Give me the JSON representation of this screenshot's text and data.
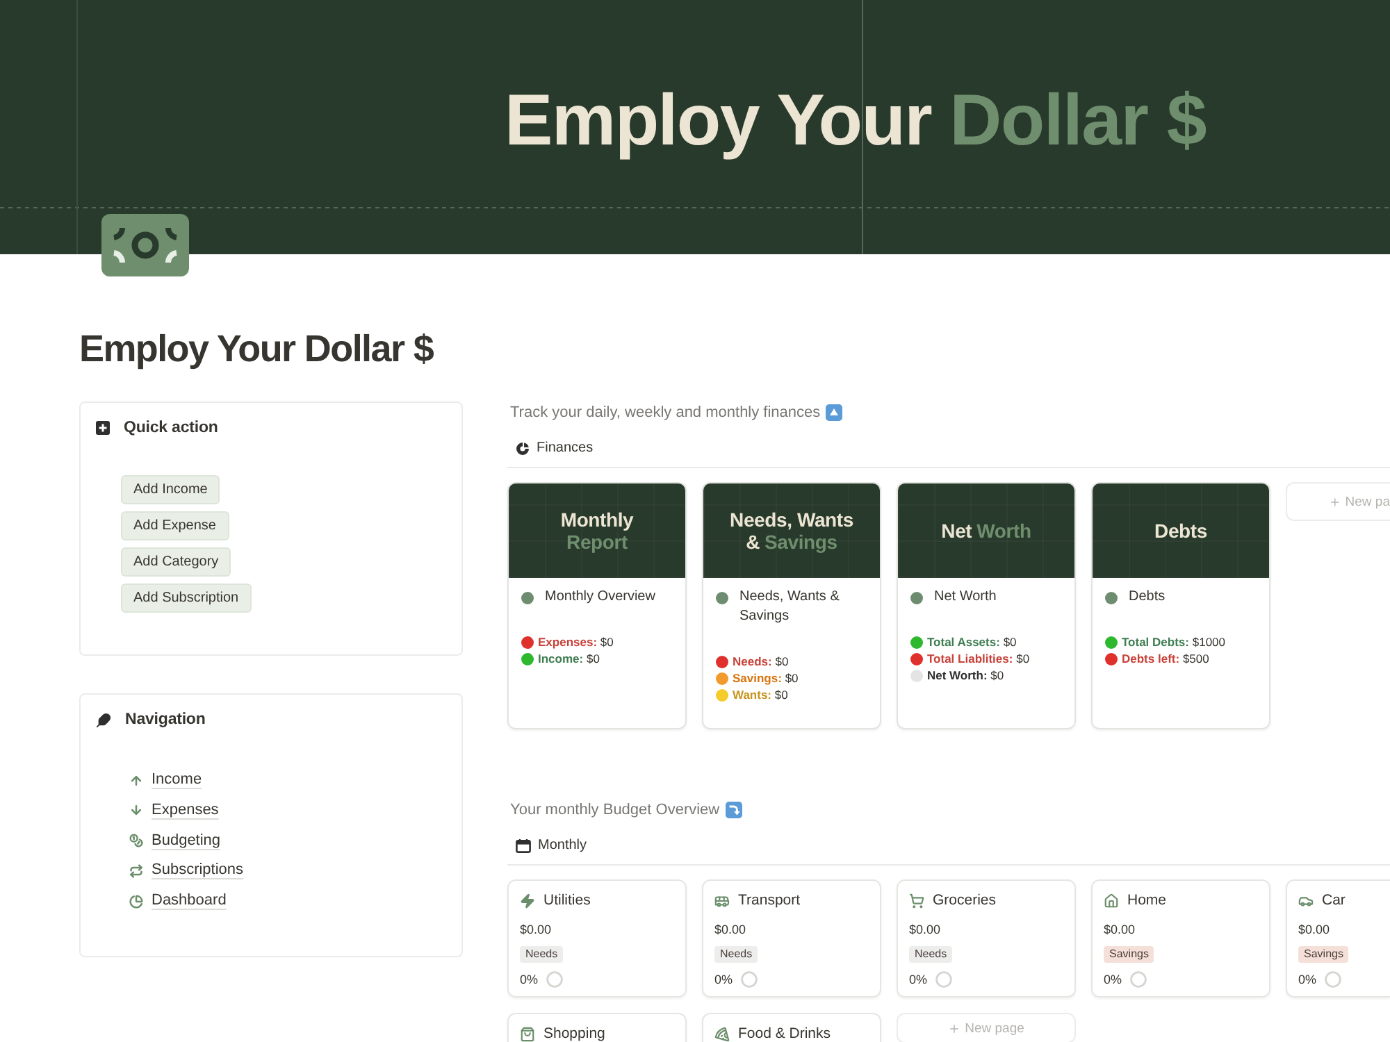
{
  "banner": {
    "title": [
      {
        "text": "Employ Your",
        "accent": false
      },
      {
        "text": "Dollar $",
        "accent": true
      }
    ]
  },
  "page": {
    "title": "Employ Your Dollar $"
  },
  "quick_action": {
    "title": "Quick action",
    "buttons": [
      "Add Income",
      "Add Expense",
      "Add Category",
      "Add Subscription"
    ]
  },
  "navigation": {
    "title": "Navigation",
    "links": [
      "Income",
      "Expenses",
      "Budgeting",
      "Subscriptions",
      "Dashboard"
    ]
  },
  "finances": {
    "intro": "Track your daily, weekly and monthly finances",
    "view": "Finances",
    "cards": [
      {
        "cover": [
          [
            {
              "text": "Monthly",
              "accent": false
            }
          ],
          [
            {
              "text": "Report",
              "accent": true
            }
          ]
        ],
        "title": "Monthly Overview",
        "stats": [
          {
            "label": "Expenses:",
            "value": "$0",
            "kind": "negative",
            "color": "#e0302c"
          },
          {
            "label": "Income:",
            "value": "$0",
            "kind": "positive",
            "color": "#2eb82e"
          }
        ]
      },
      {
        "cover": [
          [
            {
              "text": "Needs, Wants",
              "accent": false
            }
          ],
          [
            {
              "text": "&",
              "accent": false
            },
            {
              "text": "Savings",
              "accent": true
            }
          ]
        ],
        "title": "Needs, Wants & Savings",
        "stats": [
          {
            "label": "Needs:",
            "value": "$0",
            "kind": "negative",
            "color": "#e0302c"
          },
          {
            "label": "Savings:",
            "value": "$0",
            "kind": "caution",
            "color": "#f29a2e"
          },
          {
            "label": "Wants:",
            "value": "$0",
            "kind": "mild",
            "color": "#f5cc2a"
          }
        ]
      },
      {
        "cover": [
          [
            {
              "text": "Net",
              "accent": false
            },
            {
              "text": "Worth",
              "accent": true
            }
          ]
        ],
        "title": "Net Worth",
        "stats": [
          {
            "label": "Total Assets:",
            "value": "$0",
            "kind": "positive",
            "color": "#2eb82e"
          },
          {
            "label": "Total Liablities:",
            "value": "$0",
            "kind": "negative",
            "color": "#e0302c"
          },
          {
            "label": "Net Worth:",
            "value": "$0",
            "kind": "neutral",
            "color": "#e4e4e4"
          }
        ]
      },
      {
        "cover": [
          [
            {
              "text": "Debts",
              "accent": false
            }
          ]
        ],
        "title": "Debts",
        "stats": [
          {
            "label": "Total Debts:",
            "value": "$1000",
            "kind": "positive",
            "color": "#2eb82e"
          },
          {
            "label": "Debts left:",
            "value": "$500",
            "kind": "negative",
            "color": "#e0302c"
          }
        ]
      }
    ],
    "new_page": "New pa"
  },
  "budget": {
    "intro": "Your monthly Budget Overview",
    "view": "Monthly",
    "cards": [
      {
        "name": "Utilities",
        "amount": "$0.00",
        "tag": {
          "label": "Needs",
          "color": "#ededec"
        },
        "percent": "0%"
      },
      {
        "name": "Transport",
        "amount": "$0.00",
        "tag": {
          "label": "Needs",
          "color": "#ededec"
        },
        "percent": "0%"
      },
      {
        "name": "Groceries",
        "amount": "$0.00",
        "tag": {
          "label": "Needs",
          "color": "#ededec"
        },
        "percent": "0%"
      },
      {
        "name": "Home",
        "amount": "$0.00",
        "tag": {
          "label": "Savings",
          "color": "#f5e0d9"
        },
        "percent": "0%"
      },
      {
        "name": "Car",
        "amount": "$0.00",
        "tag": {
          "label": "Savings",
          "color": "#f5e0d9"
        },
        "percent": "0%"
      },
      {
        "name": "Shopping"
      },
      {
        "name": "Food & Drinks"
      }
    ],
    "new_page": "New page"
  }
}
